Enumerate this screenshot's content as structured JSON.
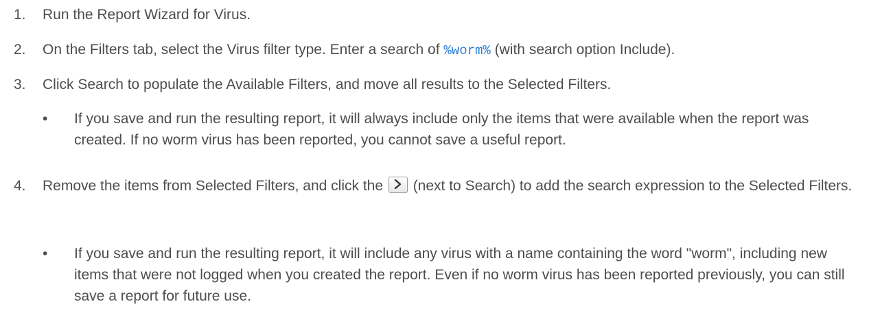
{
  "steps": [
    {
      "number": "1.",
      "text": "Run the Report Wizard for Virus."
    },
    {
      "number": "2.",
      "text_before": "On the Filters tab, select the Virus filter type. Enter a search of ",
      "code": "%worm%",
      "text_after": " (with search option Include)."
    },
    {
      "number": "3.",
      "text": "Click Search to populate the Available Filters, and move all results to the Selected Filters.",
      "bullet": {
        "symbol": "•",
        "text": "If you save and run the resulting report, it will always include only the items that were available when the report was created. If no worm virus has been reported, you cannot save a useful report."
      }
    },
    {
      "number": "4.",
      "text_before": "Remove the items from Selected Filters, and click the ",
      "icon": "chevron-right-icon",
      "text_after": " (next to Search) to add the search expression to the Selected Filters.",
      "bullet": {
        "symbol": "•",
        "text": "If you save and run the resulting report, it will include any virus with a name containing the word \"worm\", including new items that were not logged when you created the report. Even if no worm virus has been reported previously, you can still save a report for future use."
      }
    }
  ],
  "colors": {
    "text": "#4d4d4d",
    "code": "#2a7fd4"
  }
}
